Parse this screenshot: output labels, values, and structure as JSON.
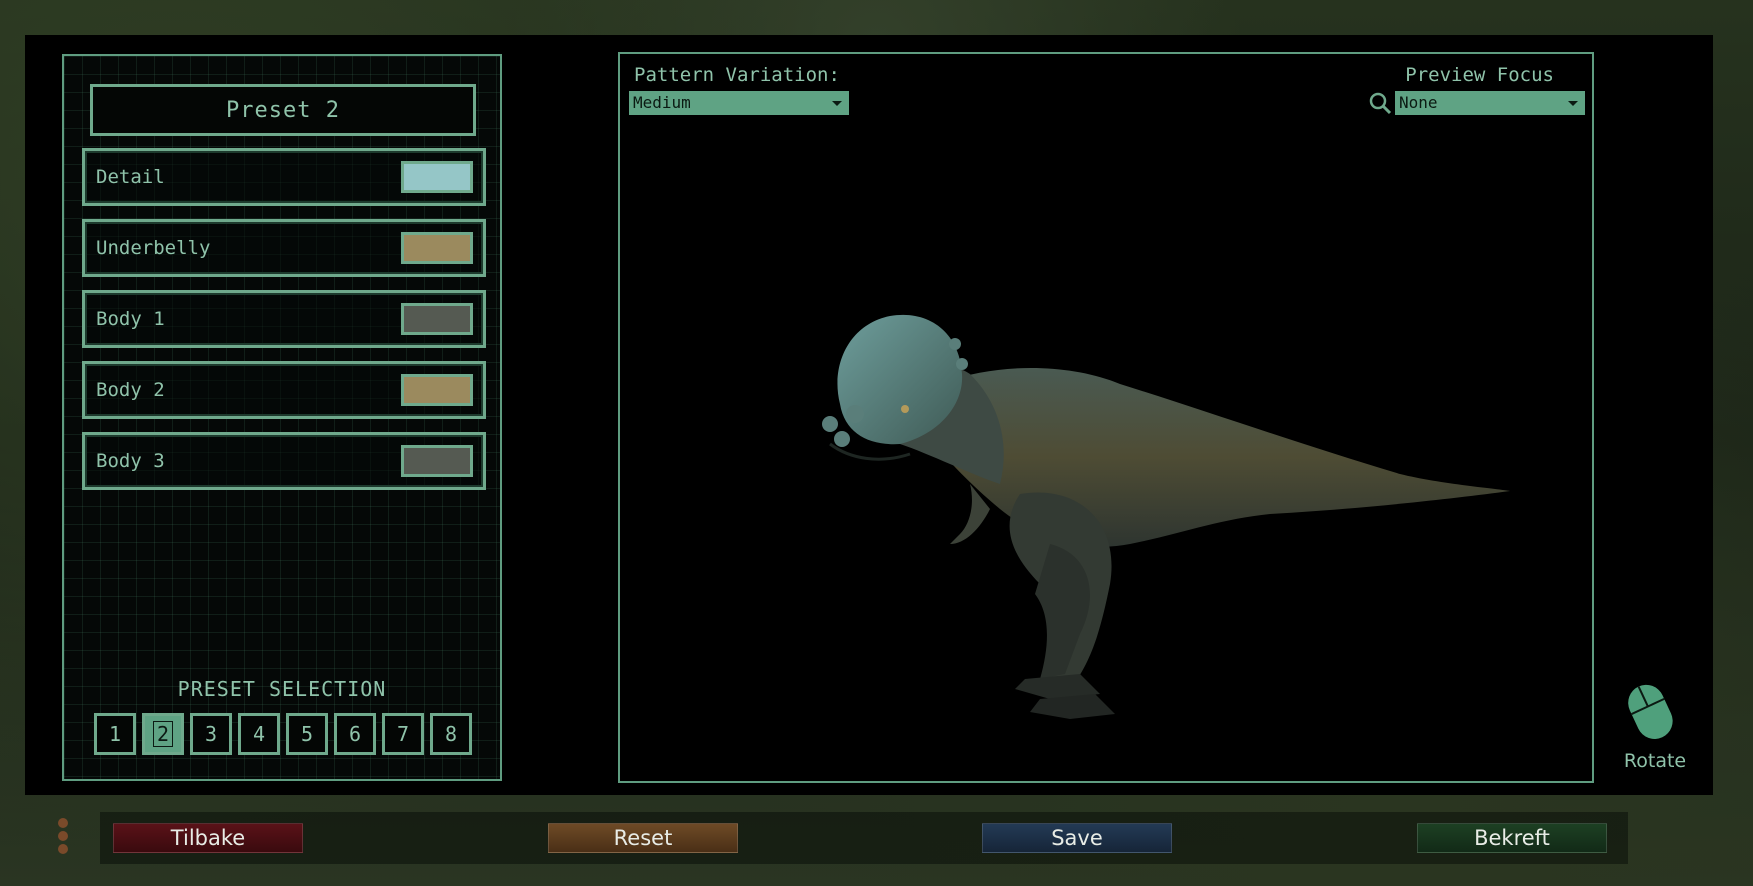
{
  "left_panel": {
    "preset_title": "Preset 2",
    "color_rows": [
      {
        "label": "Detail",
        "swatch": "#95c6c7"
      },
      {
        "label": "Underbelly",
        "swatch": "#9b8a5e"
      },
      {
        "label": "Body 1",
        "swatch": "#555a52"
      },
      {
        "label": "Body 2",
        "swatch": "#9b8a5e"
      },
      {
        "label": "Body 3",
        "swatch": "#555a52"
      }
    ],
    "preset_selection_label": "PRESET SELECTION",
    "presets": [
      "1",
      "2",
      "3",
      "4",
      "5",
      "6",
      "7",
      "8"
    ],
    "active_preset": "2"
  },
  "preview": {
    "pattern_label": "Pattern Variation:",
    "pattern_value": "Medium",
    "focus_label": "Preview Focus",
    "focus_value": "None",
    "rotate_label": "Rotate"
  },
  "buttons": {
    "back": "Tilbake",
    "reset": "Reset",
    "save": "Save",
    "confirm": "Bekreft"
  },
  "colors": {
    "accent": "#6fa98c",
    "accent_fill": "#5fa384",
    "text": "#8fc3aa"
  }
}
